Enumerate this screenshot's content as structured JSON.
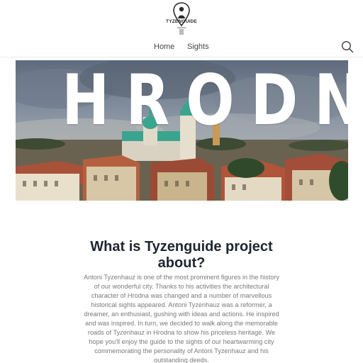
{
  "header": {
    "logo_text": "TYZENGUIDE",
    "nav": [
      {
        "label": "Home"
      },
      {
        "label": "Sights"
      }
    ],
    "search_icon": "search-icon"
  },
  "hero": {
    "title": "HRODNA"
  },
  "content": {
    "title": "What is Tyzenguide project about?",
    "body": "Antoni Tyzenhauz is one of the most prominent figures in the history of our wonderful city. Thanks to his activities the architectural character of Hrodna was changed and a number of marvellous historical sights appeared. Antoni Tyzenhauz was a reformer, a dreamer, an enthusiast, gushing with ideas and actions. He inspired and was inspired. In turn, we decided to walk along the memorable roads of Tyzenhauz in Hrodna to show his priceless heritage. We hope you'll enjoy the guide to the sights of our heartwarming city commemorating the personality of Antoni Tyzenhauz and his outstanding deeds."
  },
  "colors": {
    "accent_teal": "#3aa58e",
    "title_dark": "#1f2430",
    "body_gray": "#7a7a7a"
  }
}
